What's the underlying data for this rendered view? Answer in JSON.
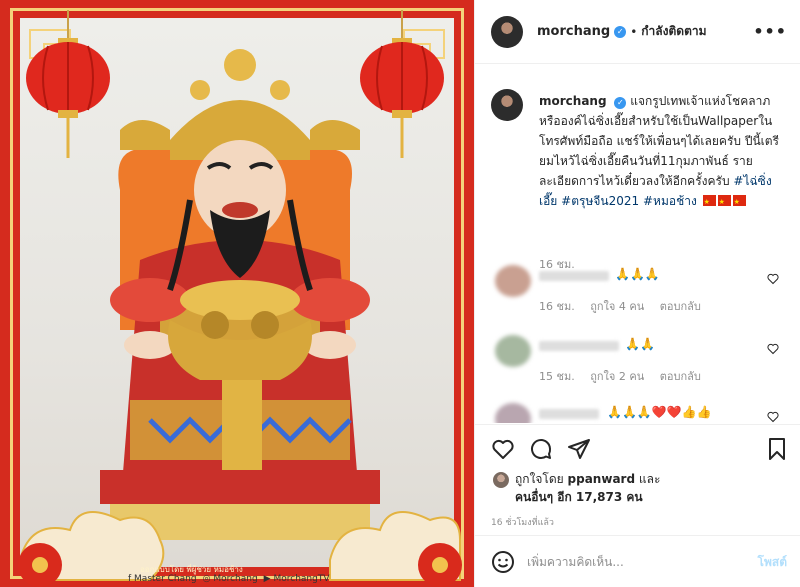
{
  "header": {
    "username": "morchang",
    "verified_icon": "verified-badge-icon",
    "separator": "•",
    "follow_status": "กำลังติดตาม",
    "more_icon": "more-options-icon"
  },
  "image": {
    "watermark_credit": "ออกแบบโดย พี่ผู้ช่วย หมอช้าง",
    "socials": [
      {
        "icon": "facebook-icon",
        "label": "Master Chang"
      },
      {
        "icon": "instagram-icon",
        "label": "Morchang"
      },
      {
        "icon": "youtube-icon",
        "label": "MorchangTV"
      }
    ],
    "accent_red": "#d52b1e",
    "accent_gold": "#f4d27a"
  },
  "caption": {
    "username": "morchang",
    "text": "แจกรูปเทพเจ้าแห่งโชคลาภหรือองค์ไฉ่ซิ่งเอี๊ยสำหรับใช้เป็นWallpaperในโทรศัพท์มือถือ แชร์ให้เพื่อนๆได้เลยครับ ปีนี้เตรียมไหว้ไฉ่ซิ่งเอี๊ยคืนวันที่11กุมภาพันธ์ รายละเอียดการไหว้เดี๋ยวลงให้อีกครั้งครับ ",
    "hashtags": [
      "#ไฉ่ซิ่งเอี๊ย",
      "#ตรุษจีน2021",
      "#หมอช้าง"
    ],
    "time": "16 ชม."
  },
  "comments": [
    {
      "emoji": "🙏🙏🙏",
      "time": "16 ชม.",
      "likes": "ถูกใจ 4 คน",
      "reply": "ตอบกลับ"
    },
    {
      "emoji": "🙏🙏",
      "time": "15 ชม.",
      "likes": "ถูกใจ 2 คน",
      "reply": "ตอบกลับ"
    },
    {
      "emoji": "🙏🙏🙏❤️❤️👍👍",
      "time": "",
      "likes": "",
      "reply": ""
    }
  ],
  "actions": {
    "like_icon": "heart-icon",
    "comment_icon": "comment-icon",
    "share_icon": "share-icon",
    "save_icon": "bookmark-icon",
    "liked_by_prefix": "ถูกใจโดย",
    "liked_by_user": "ppanward",
    "liked_by_suffix": "และ",
    "others": "คนอื่นๆ อีก 17,873 คน",
    "posted_ago": "16 ชั่วโมงที่แล้ว"
  },
  "composer": {
    "emoji_icon": "emoji-smile-icon",
    "placeholder": "เพิ่มความคิดเห็น...",
    "post_label": "โพสต์",
    "post_color": "#b2dffc"
  }
}
